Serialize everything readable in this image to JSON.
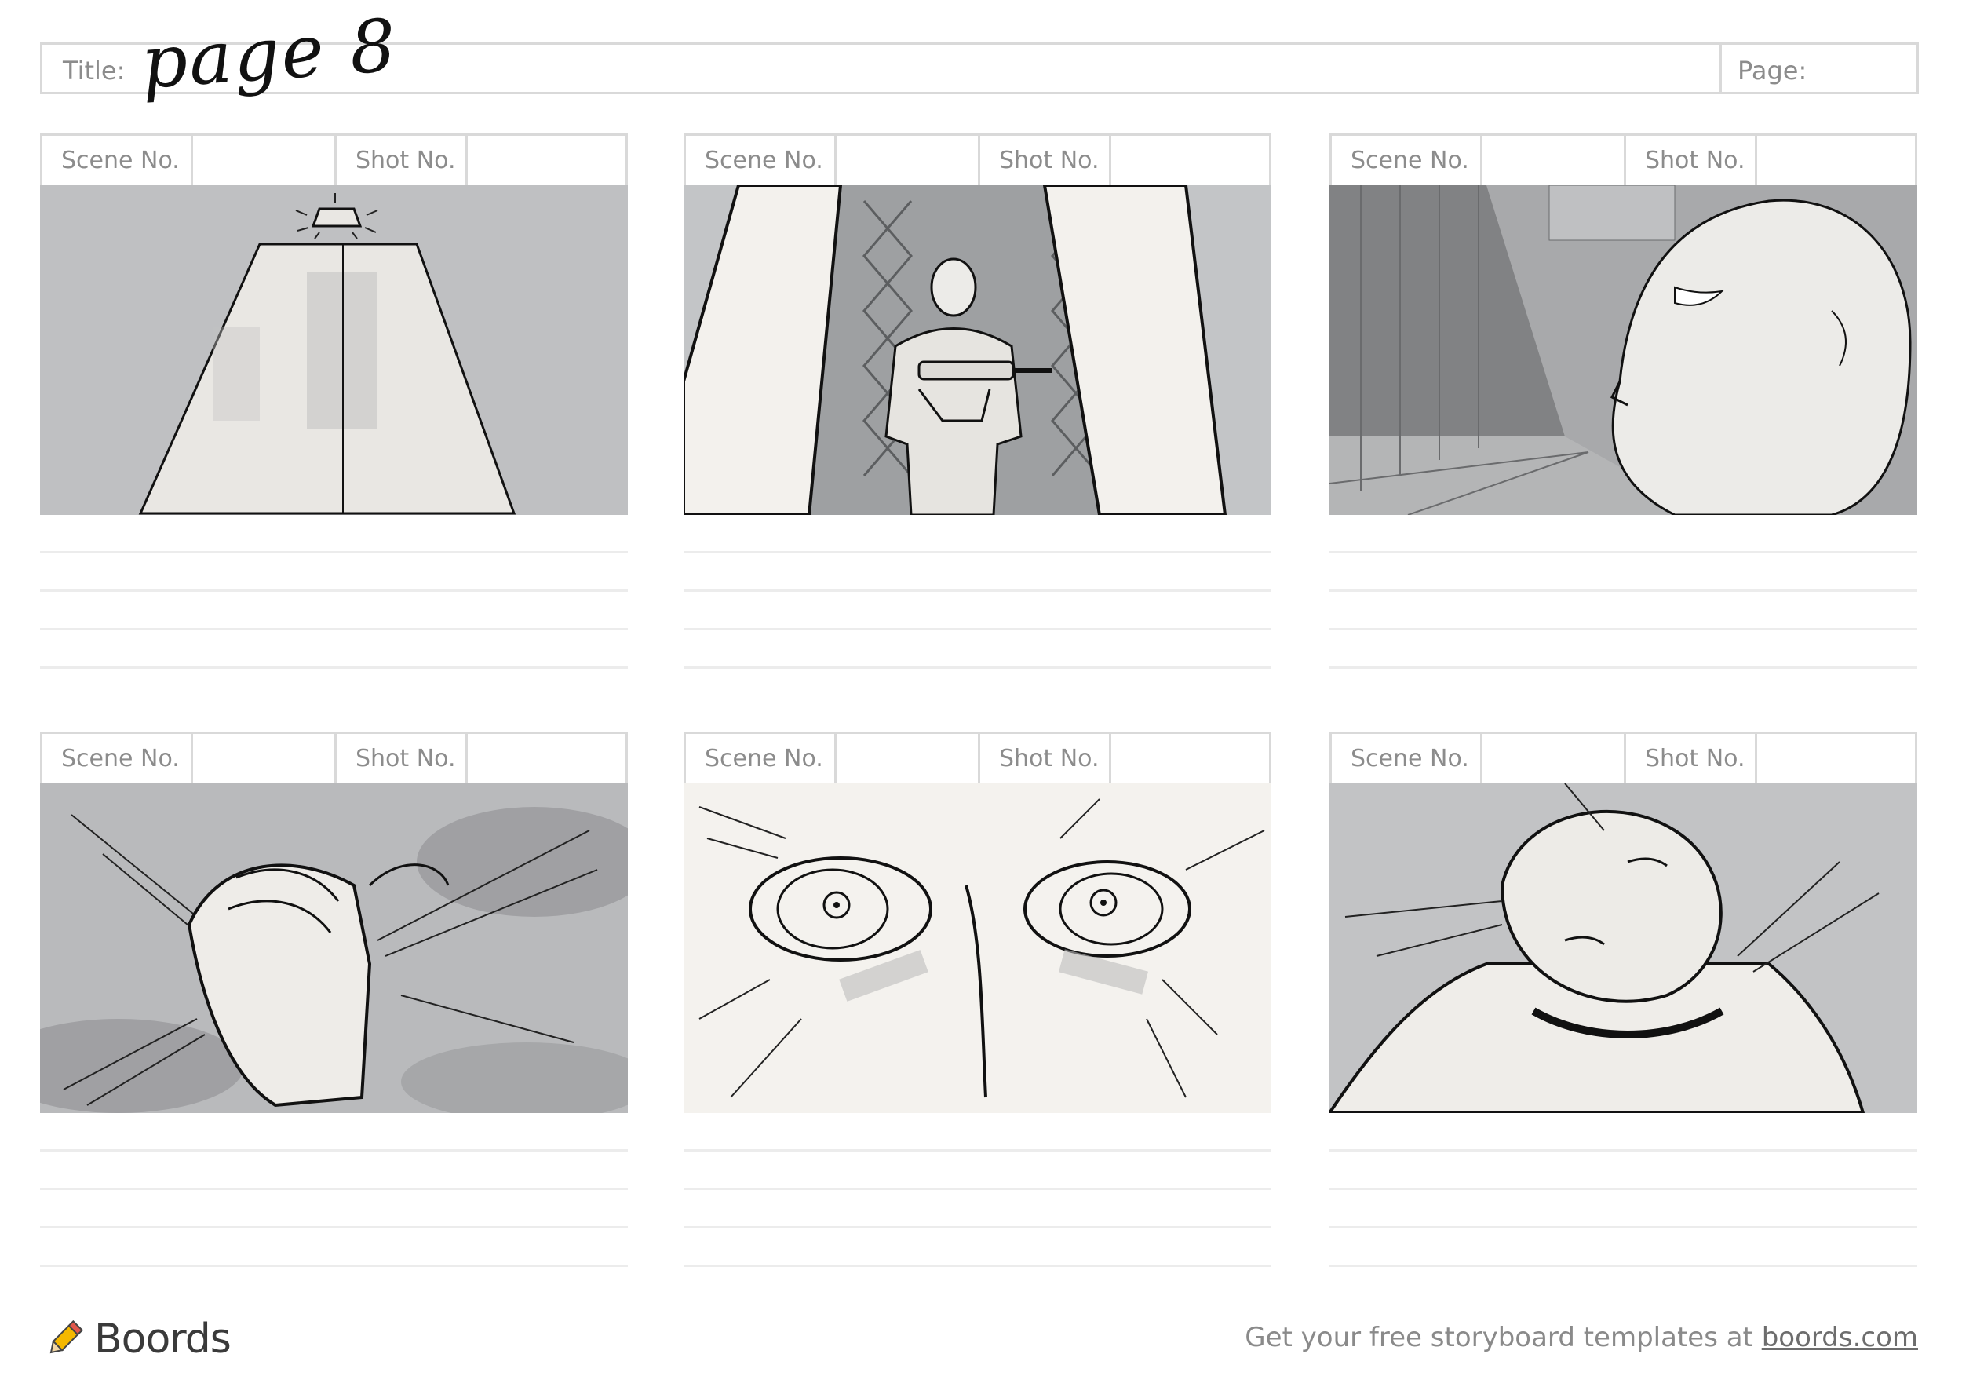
{
  "header": {
    "title_label": "Title:",
    "title_value": "page 8",
    "page_label": "Page:"
  },
  "panels": [
    {
      "scene_label": "Scene No.",
      "shot_label": "Shot No."
    },
    {
      "scene_label": "Scene No.",
      "shot_label": "Shot No."
    },
    {
      "scene_label": "Scene No.",
      "shot_label": "Shot No."
    },
    {
      "scene_label": "Scene No.",
      "shot_label": "Shot No."
    },
    {
      "scene_label": "Scene No.",
      "shot_label": "Shot No."
    },
    {
      "scene_label": "Scene No.",
      "shot_label": "Shot No."
    }
  ],
  "footer": {
    "brand": "Boords",
    "brand_icon": "pencil-icon",
    "tagline": "Get your free storyboard templates at",
    "link_text": "boords.com"
  },
  "colors": {
    "border": "#d9d9d9",
    "panel_gray": "#bfc0c2",
    "panel_light": "#f4f2ee",
    "text_gray": "#8c8c8c"
  }
}
